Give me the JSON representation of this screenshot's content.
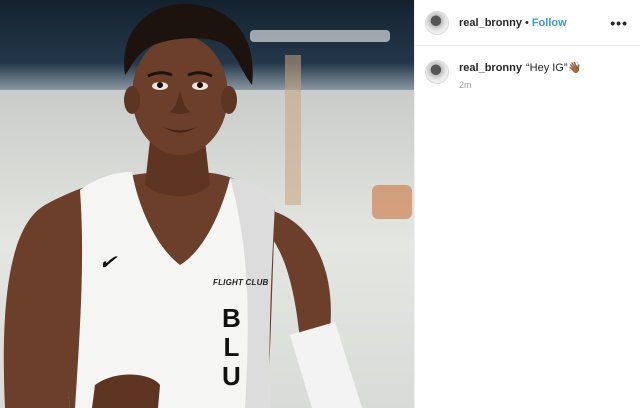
{
  "post": {
    "author": {
      "username": "real_bronny",
      "separator": "•",
      "follow_label": "Follow",
      "more_icon": "more-options-icon"
    },
    "caption": {
      "username": "real_bronny",
      "text": "“Hey IG”👋🏾",
      "timestamp": "2m"
    },
    "photo": {
      "jersey_brand_icon": "swoosh-logo",
      "jersey_team": "FLIGHT CLUB",
      "jersey_letters": [
        "B",
        "L",
        "U"
      ]
    }
  },
  "colors": {
    "link": "#3897f0",
    "text": "#262626",
    "muted": "#999999",
    "divider": "#efefef"
  }
}
